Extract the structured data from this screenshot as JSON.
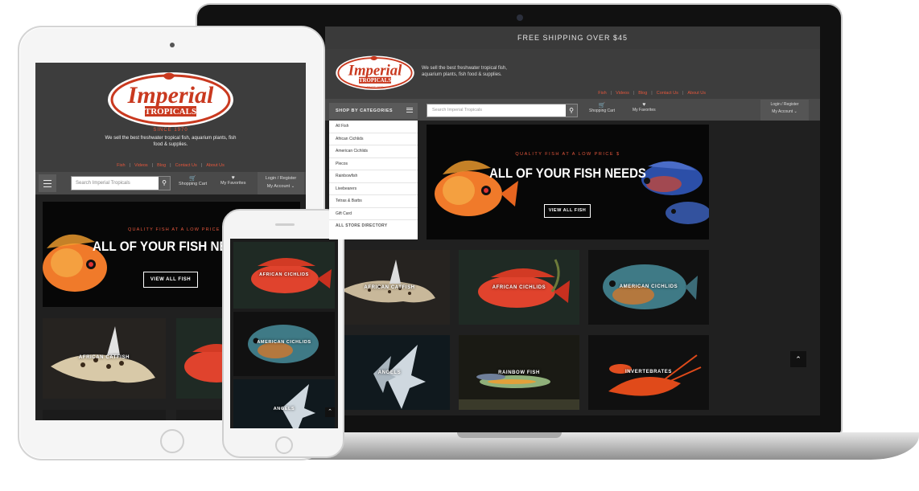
{
  "brand": {
    "name_line1": "Imperial",
    "name_line2": "TROPICALS",
    "since": "SINCE 1970",
    "tagline": "We sell the best freshwater tropical fish, aquarium plants, fish food & supplies."
  },
  "colors": {
    "accent": "#e4573d",
    "header_bg": "#3d3d3d",
    "nav_bg": "#4a4a4a",
    "page_bg": "#202020"
  },
  "topbar": {
    "text": "FREE SHIPPING OVER $45"
  },
  "links": [
    "Fish",
    "Videos",
    "Blog",
    "Contact Us",
    "About Us"
  ],
  "categories": {
    "heading": "SHOP BY CATEGORIES",
    "items": [
      "All Fish",
      "African Cichlids",
      "American Cichlids",
      "Plecos",
      "Rainbowfish",
      "Livebearers",
      "Tetras & Barbs",
      "Gift Card",
      "ALL STORE DIRECTORY"
    ]
  },
  "search": {
    "placeholder": "Search Imperial Tropicals"
  },
  "toolbar": {
    "cart": "Shopping Cart",
    "favorites": "My Favorites",
    "login": "Login / Register",
    "account": "My Account"
  },
  "hero": {
    "kicker": "QUALITY FISH AT A LOW PRICE $",
    "title": "ALL OF YOUR FISH NEEDS",
    "title_tablet": "ALL OF YOUR FISH NE",
    "button": "VIEW ALL FISH"
  },
  "tiles": {
    "african_catfish": "AFRICAN CATFISH",
    "african_cichlids": "AFRICAN CICHLIDS",
    "american_cichlids": "AMERICAN CICHLIDS",
    "angels": "ANGELS",
    "rainbow_fish": "RAINBOW FISH",
    "invertebrates": "INVERTEBRATES"
  },
  "icons": {
    "search": "search-icon",
    "cart": "cart-icon",
    "heart": "heart-icon",
    "menu": "hamburger-icon",
    "up": "chevron-up-icon"
  }
}
